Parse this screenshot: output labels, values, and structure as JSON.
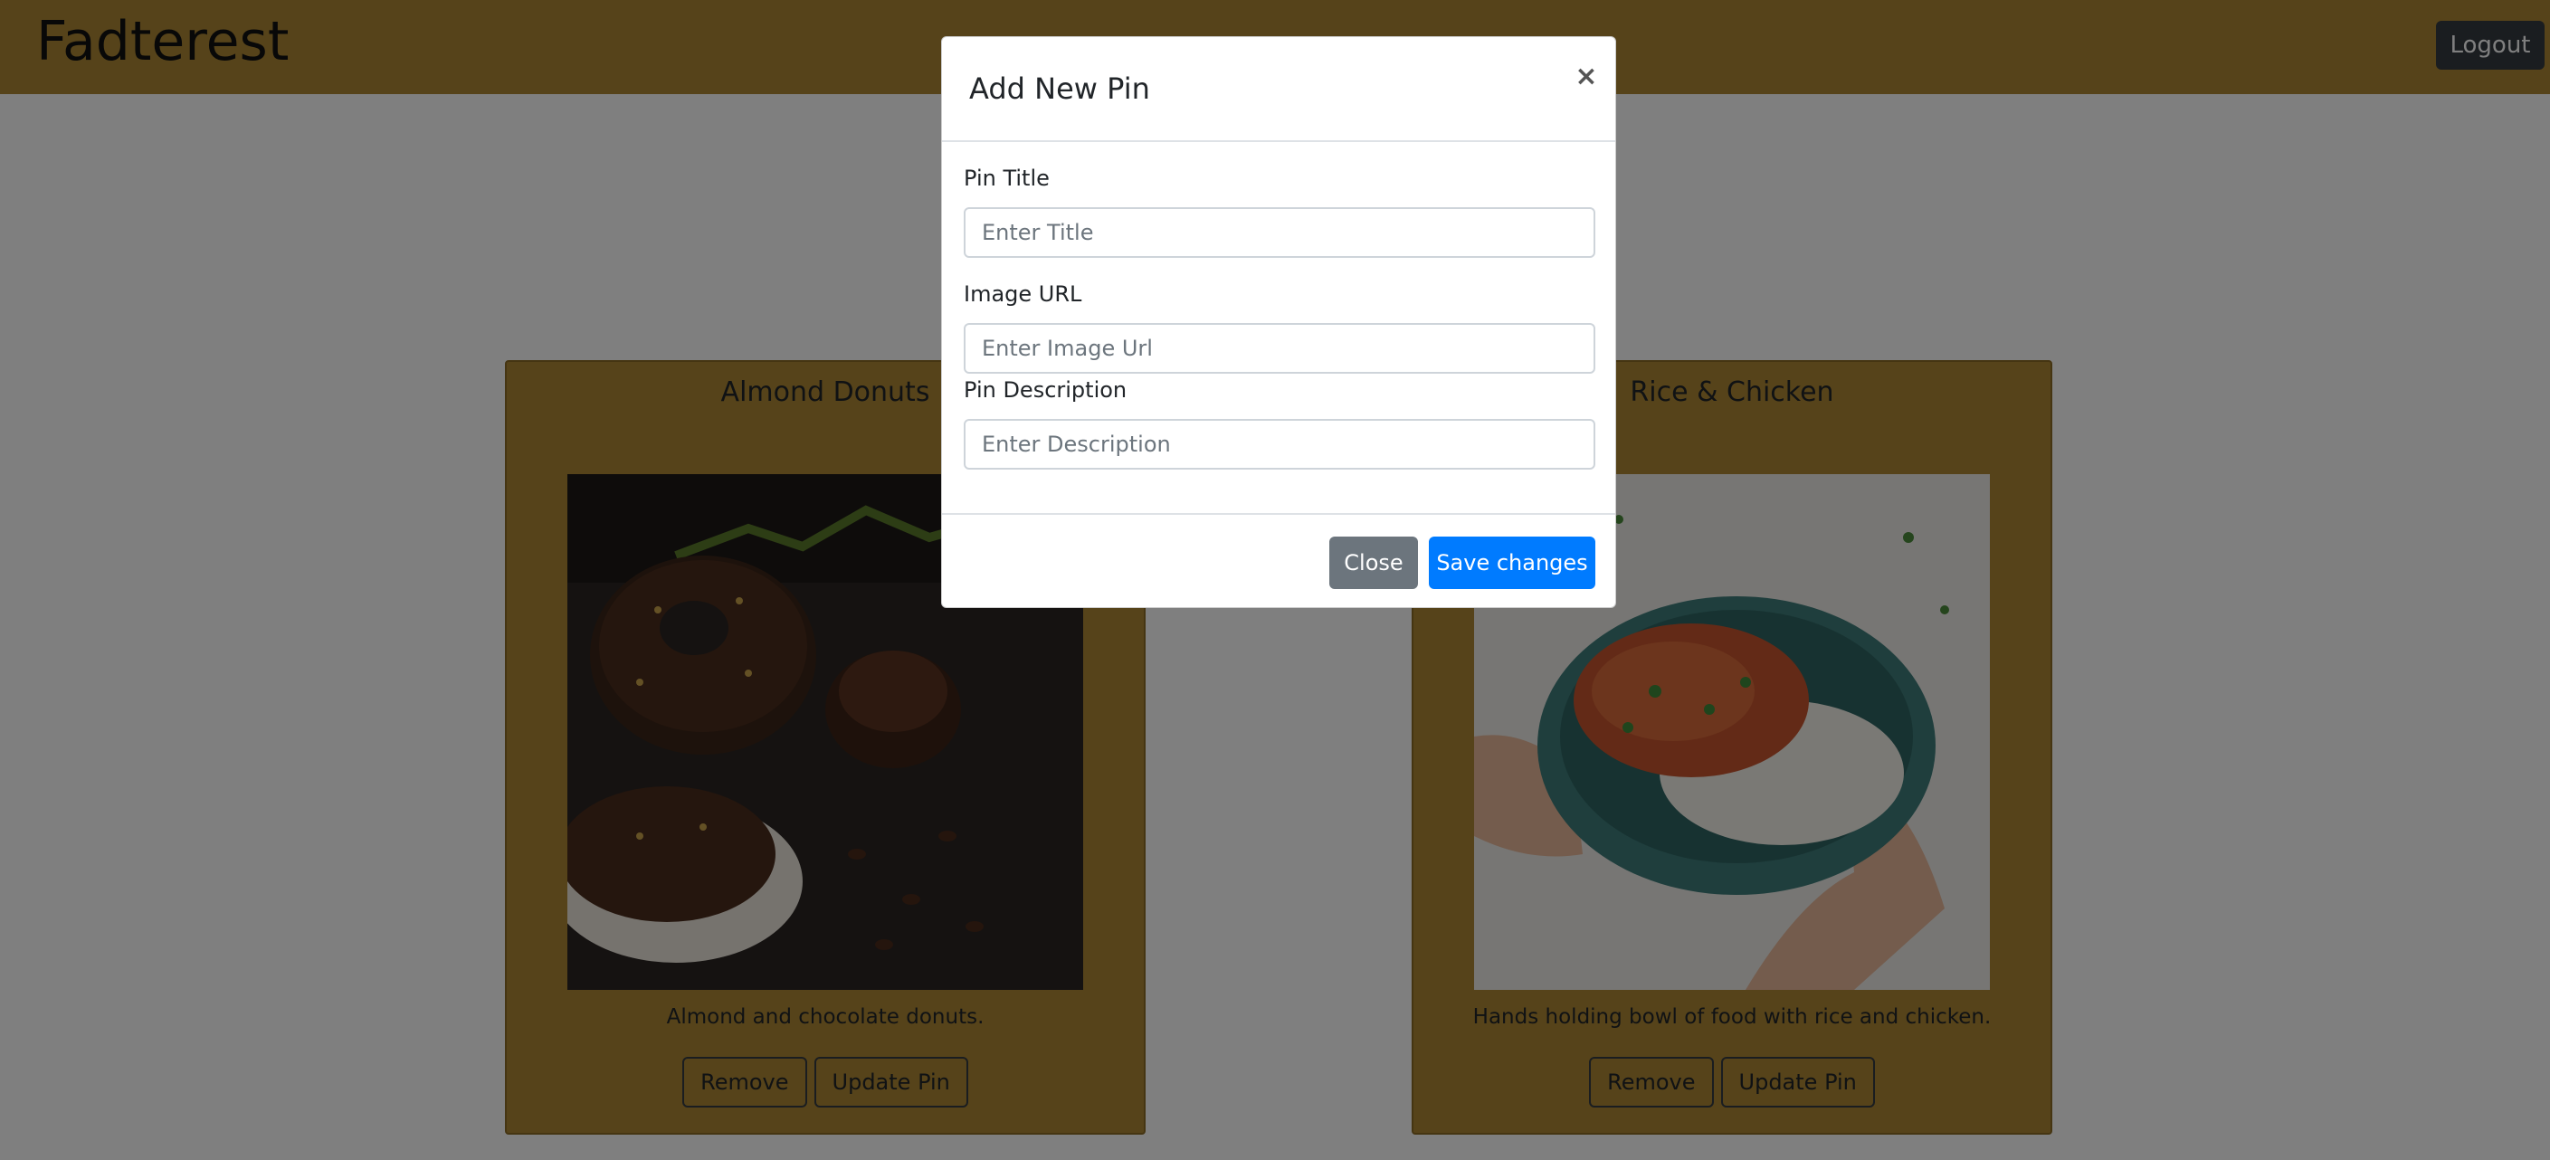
{
  "app": {
    "brand": "Fadterest",
    "logout_label": "Logout"
  },
  "colors": {
    "navbar": "#ad8734",
    "card": "#ad8734",
    "primary": "#007bff",
    "secondary": "#6c757d",
    "dark": "#343a40"
  },
  "pins": [
    {
      "title": "Almond Donuts",
      "description": "Almond and chocolate donuts.",
      "image_icon": "donuts-photo",
      "remove_label": "Remove",
      "update_label": "Update Pin"
    },
    {
      "title": "Rice & Chicken",
      "description": "Hands holding bowl of food with rice and chicken.",
      "image_icon": "rice-bowl-photo",
      "remove_label": "Remove",
      "update_label": "Update Pin"
    }
  ],
  "modal": {
    "title": "Add New Pin",
    "close_icon": "×",
    "fields": [
      {
        "label": "Pin Title",
        "placeholder": "Enter Title",
        "value": ""
      },
      {
        "label": "Image URL",
        "placeholder": "Enter Image Url",
        "value": ""
      },
      {
        "label": "Pin Description",
        "placeholder": "Enter Description",
        "value": ""
      }
    ],
    "close_label": "Close",
    "save_label": "Save changes"
  }
}
